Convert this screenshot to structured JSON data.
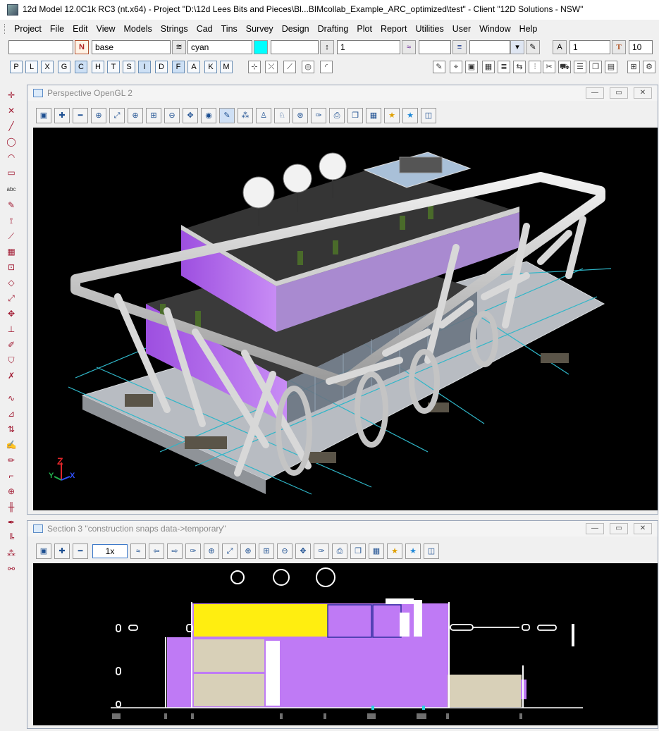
{
  "window": {
    "title": "12d Model  12.0C1k RC3 (nt.x64) - Project \"D:\\12d Lees Bits and Pieces\\Bl...BIMcollab_Example_ARC_optimized\\test\" - Client \"12D Solutions - NSW\""
  },
  "menu": [
    "Project",
    "File",
    "Edit",
    "View",
    "Models",
    "Strings",
    "Cad",
    "Tins",
    "Survey",
    "Design",
    "Drafting",
    "Plot",
    "Report",
    "Utilities",
    "User",
    "Window",
    "Help"
  ],
  "propbar": {
    "name_value": "",
    "name_icon": "N",
    "model_value": "base",
    "colour_value": "cyan",
    "colour_hex": "#00ffff",
    "style_value": "",
    "z_value": "1",
    "weight_value": "",
    "textstyle_value": "",
    "text_size_value": "1",
    "text_icon": "T",
    "text_height_value": "10"
  },
  "letters": [
    "P",
    "L",
    "X",
    "G",
    "C",
    "H",
    "T",
    "S",
    "I",
    "D",
    "F",
    "A",
    "K",
    "M"
  ],
  "letters_on": [
    "C",
    "I",
    "F"
  ],
  "panel1": {
    "title": "Perspective OpenGL 2"
  },
  "panel2": {
    "title": "Section 3 \"construction snaps data->temporary\"",
    "zoom_label": "1x"
  },
  "axes": {
    "z": "Z",
    "x": "X",
    "y": "Y"
  },
  "colors": {
    "accent_purple": "#b45cf0",
    "yellow": "#ffee10",
    "cyan_grid": "#2fb6c8",
    "beige": "#d8d0b8"
  }
}
